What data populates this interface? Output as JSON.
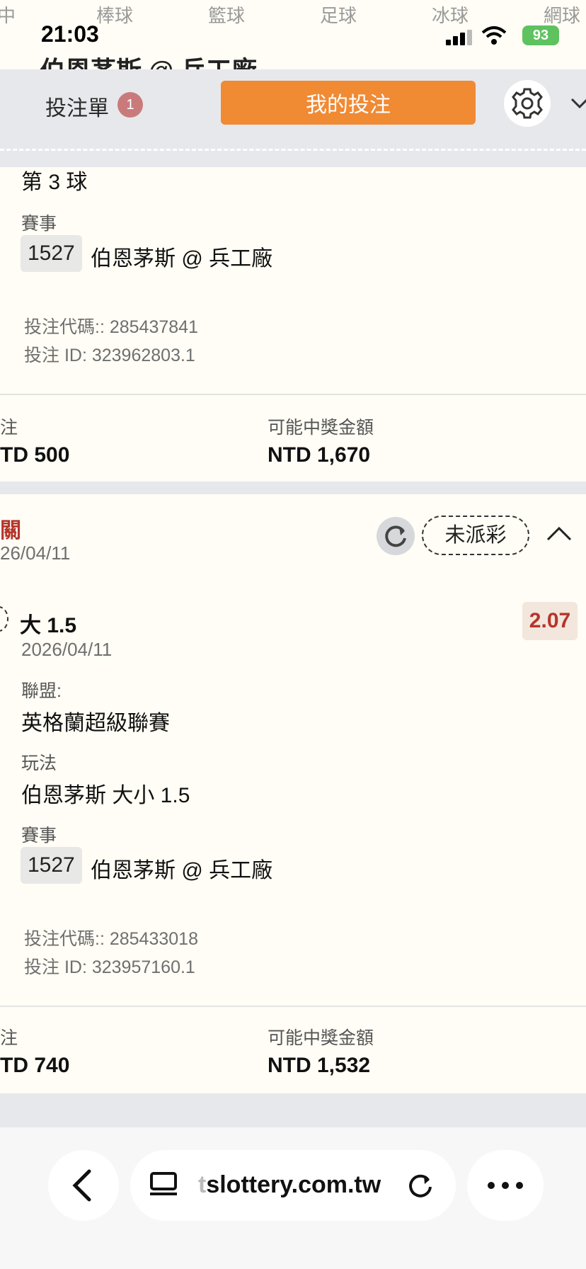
{
  "sport_bar": [
    "中",
    "棒球",
    "籃球",
    "足球",
    "冰球",
    "網球"
  ],
  "status": {
    "time": "21:03",
    "battery": "93"
  },
  "behind_title": "伯恩茅斯 @ 兵工廠",
  "header": {
    "betslip_label": "投注單",
    "betslip_count": "1",
    "my_bets_label": "我的投注"
  },
  "bet1": {
    "selection": "第 3 球",
    "event_label": "賽事",
    "event_code": "1527",
    "event_name": "伯恩茅斯 @ 兵工廠",
    "bet_code": "投注代碼:: 285437841",
    "bet_id": "投注 ID: 323962803.1",
    "stake_label": "注",
    "stake": "TD 500",
    "win_label": "可能中獎金額",
    "win": "NTD 1,670"
  },
  "bet2": {
    "type": "關",
    "date": "26/04/11",
    "status": "未派彩",
    "selection": "大 1.5",
    "selection_date": "2026/04/11",
    "odds": "2.07",
    "league_label": "聯盟:",
    "league": "英格蘭超級聯賽",
    "market_label": "玩法",
    "market": "伯恩茅斯 大小 1.5",
    "event_label": "賽事",
    "event_code": "1527",
    "event_name": "伯恩茅斯 @ 兵工廠",
    "bet_code": "投注代碼:: 285433018",
    "bet_id": "投注 ID: 323957160.1",
    "stake_label": "注",
    "stake": "TD 740",
    "win_label": "可能中獎金額",
    "win": "NTD 1,532"
  },
  "browser": {
    "url_prefix": "t",
    "url": "slottery.com.tw"
  },
  "colors": {
    "accent": "#f08a33",
    "odds_red": "#b5352b",
    "header_bg": "#e7e8eb"
  }
}
